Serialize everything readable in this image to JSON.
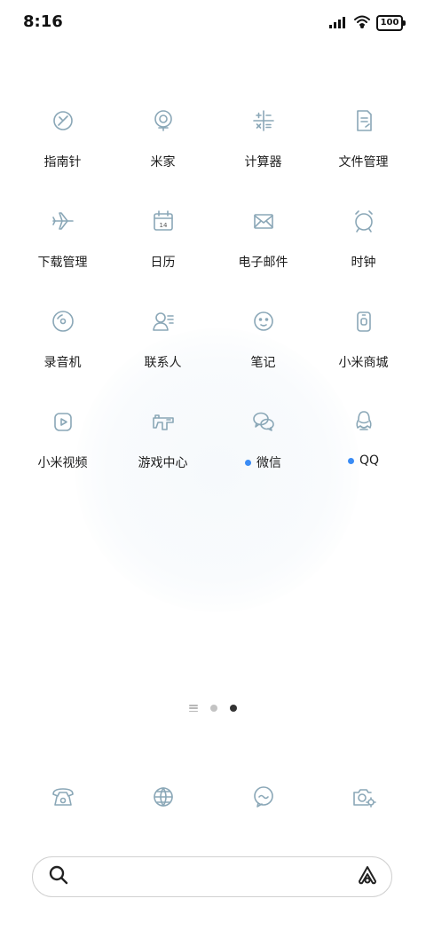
{
  "status_bar": {
    "time": "8:16",
    "battery": "100"
  },
  "apps": [
    {
      "label": "指南针",
      "icon": "compass-icon",
      "dot": false
    },
    {
      "label": "米家",
      "icon": "mijia-icon",
      "dot": false
    },
    {
      "label": "计算器",
      "icon": "calculator-icon",
      "dot": false
    },
    {
      "label": "文件管理",
      "icon": "file-manager-icon",
      "dot": false
    },
    {
      "label": "下载管理",
      "icon": "airplane-download-icon",
      "dot": false
    },
    {
      "label": "日历",
      "icon": "calendar-icon",
      "dot": false,
      "day": "14"
    },
    {
      "label": "电子邮件",
      "icon": "mail-icon",
      "dot": false
    },
    {
      "label": "时钟",
      "icon": "alarm-clock-icon",
      "dot": false
    },
    {
      "label": "录音机",
      "icon": "recorder-icon",
      "dot": false
    },
    {
      "label": "联系人",
      "icon": "contacts-icon",
      "dot": false
    },
    {
      "label": "笔记",
      "icon": "notes-icon",
      "dot": false
    },
    {
      "label": "小米商城",
      "icon": "mi-store-icon",
      "dot": false
    },
    {
      "label": "小米视频",
      "icon": "mi-video-icon",
      "dot": false
    },
    {
      "label": "游戏中心",
      "icon": "game-center-icon",
      "dot": false
    },
    {
      "label": "微信",
      "icon": "wechat-icon",
      "dot": true
    },
    {
      "label": "QQ",
      "icon": "qq-icon",
      "dot": true
    }
  ],
  "page_indicator": {
    "pages": 2,
    "active": 2
  },
  "dock": [
    {
      "icon": "phone-icon"
    },
    {
      "icon": "browser-globe-icon"
    },
    {
      "icon": "messages-icon"
    },
    {
      "icon": "camera-icon"
    }
  ],
  "search": {
    "placeholder": ""
  },
  "colors": {
    "icon_stroke": "#8aa7b7",
    "notification_dot": "#3a8cf5",
    "active_page_dot": "#333333"
  }
}
